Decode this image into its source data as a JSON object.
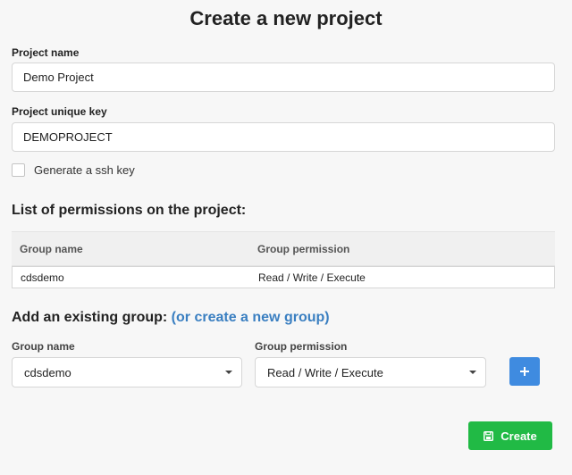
{
  "page": {
    "title": "Create a new project"
  },
  "form": {
    "project_name_label": "Project name",
    "project_name_value": "Demo Project",
    "project_key_label": "Project unique key",
    "project_key_value": "DEMOPROJECT",
    "ssh_key_label": "Generate a ssh key",
    "ssh_key_checked": false
  },
  "permissions": {
    "title": "List of permissions on the project:",
    "columns": [
      "Group name",
      "Group permission"
    ],
    "rows": [
      {
        "group": "cdsdemo",
        "permission": "Read / Write / Execute"
      }
    ]
  },
  "add_group": {
    "title": "Add an existing group:",
    "create_link": "(or create a new group)",
    "group_label": "Group name",
    "group_value": "cdsdemo",
    "permission_label": "Group permission",
    "permission_value": "Read / Write / Execute",
    "add_icon": "plus-icon"
  },
  "actions": {
    "create_label": "Create",
    "create_icon": "save-icon"
  },
  "colors": {
    "primary_blue": "#3f8be0",
    "link_blue": "#3a7fc1",
    "create_green": "#21ba45",
    "background": "#f7f7f7"
  }
}
